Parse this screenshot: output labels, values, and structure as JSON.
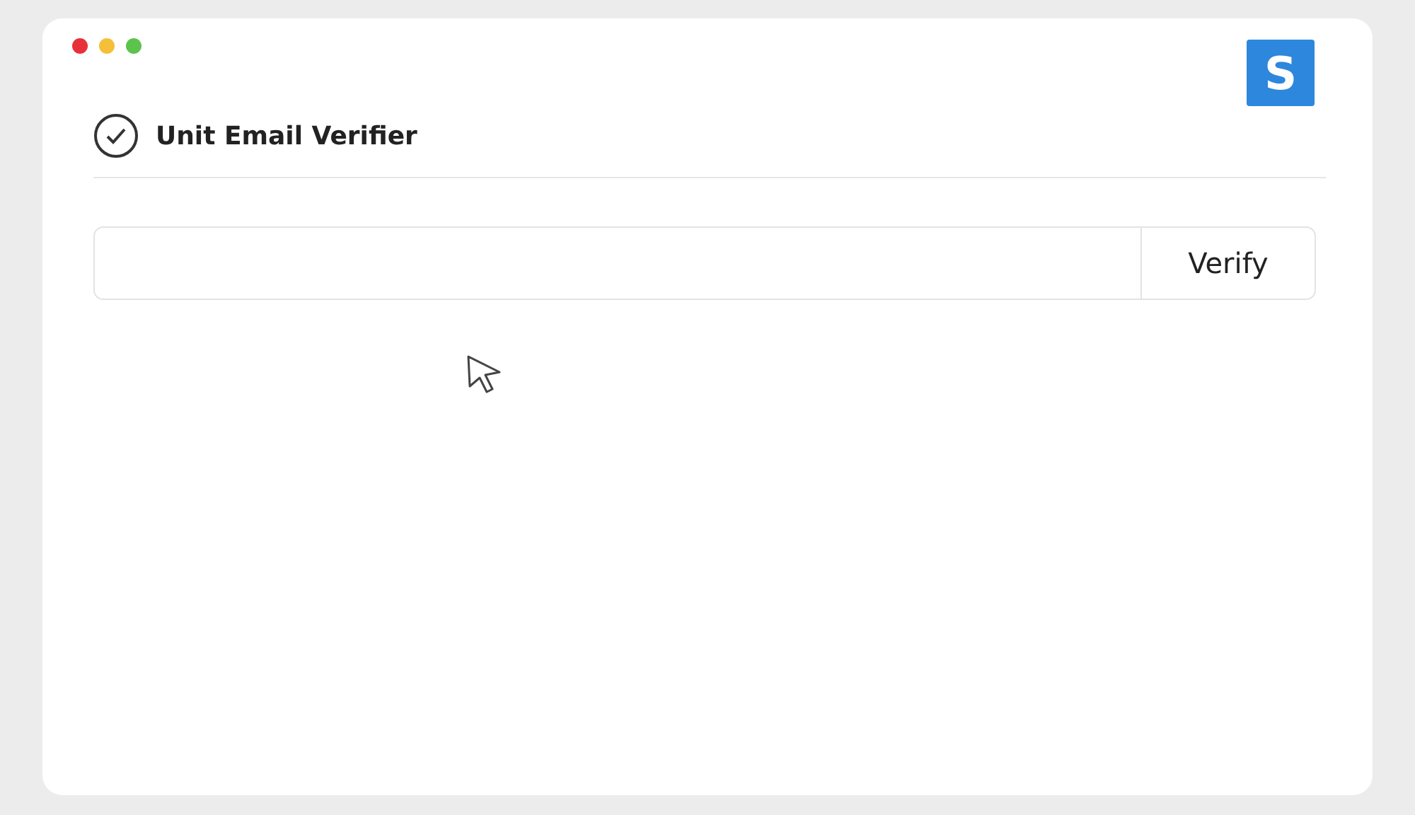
{
  "window": {
    "controls": [
      {
        "color": "#e8303a"
      },
      {
        "color": "#f6bf3a"
      },
      {
        "color": "#5cc44c"
      }
    ],
    "logo": "S"
  },
  "header": {
    "title": "Unit Email Verifier"
  },
  "form": {
    "button": "Verify"
  }
}
